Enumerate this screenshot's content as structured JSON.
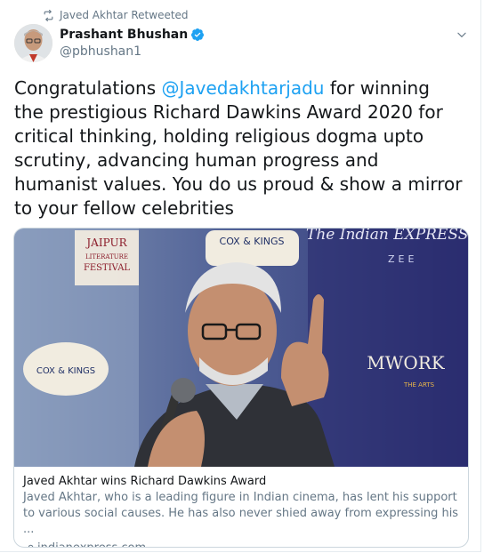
{
  "retweet": {
    "label": "Javed Akhtar Retweeted"
  },
  "author": {
    "name": "Prashant Bhushan",
    "handle": "@pbhushan1",
    "verified": true
  },
  "tweet": {
    "text_before": "Congratulations ",
    "mention": "@Javedakhtarjadu",
    "text_after": " for winning the prestigious Richard Dawkins Award 2020 for critical thinking, holding religious dogma upto scrutiny, advancing human progress and humanist values. You do us proud & show a mirror to your fellow celebrities"
  },
  "card": {
    "image_banners": {
      "jaipur": [
        "JAIPUR",
        "LITERATURE",
        "FESTIVAL"
      ],
      "cox_kings": "COX & KINGS",
      "indian_express": "The Indian EXPRESS",
      "zee": "ZEE",
      "mwork": "MWORK",
      "mwork_sub": "THE ARTS"
    },
    "title": "Javed Akhtar wins Richard Dawkins Award",
    "description": "Javed Akhtar, who is a leading figure in Indian cinema, has lent his support to various social causes. He has also never shied away from expressing his ...",
    "domain": "indianexpress.com"
  },
  "colors": {
    "link": "#1da1f2",
    "secondary": "#657786",
    "border": "#ccd6dd",
    "verified": "#1da1f2"
  },
  "icons": {
    "retweet": "retweet-icon",
    "verified": "verified-badge-icon",
    "menu": "chevron-down-icon",
    "link": "link-icon"
  }
}
